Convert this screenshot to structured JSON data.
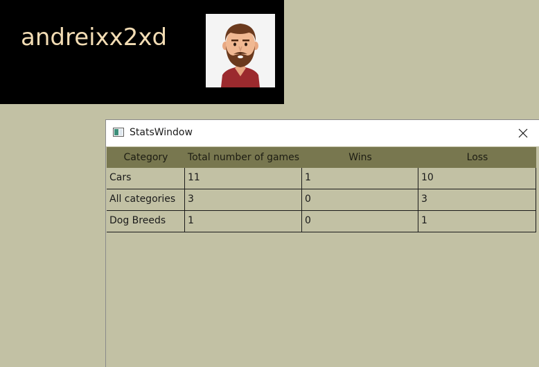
{
  "profile": {
    "username": "andreixx2xd",
    "avatar_icon": "bearded-man-avatar"
  },
  "stats_window": {
    "title": "StatsWindow",
    "app_icon": "window-app-icon",
    "close_icon": "close-icon",
    "columns": [
      "Category",
      "Total number of games",
      "Wins",
      "Loss"
    ],
    "rows": [
      [
        "Cars",
        "11",
        "1",
        "10"
      ],
      [
        "All categories",
        "3",
        "0",
        "3"
      ],
      [
        "Dog Breeds",
        "1",
        "0",
        "1"
      ]
    ]
  },
  "colors": {
    "background": "#c2c1a4",
    "header_bg": "#78774f",
    "profile_bg": "#000000",
    "username_color": "#f2dcb4"
  }
}
